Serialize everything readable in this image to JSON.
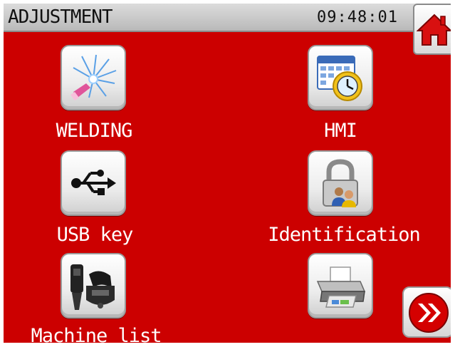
{
  "header": {
    "title": "ADJUSTMENT",
    "time": "09:48:01"
  },
  "menu": {
    "welding": "WELDING",
    "hmi": "HMI",
    "usb_key": "USB key",
    "identification": "Identification",
    "machine_list": "Machine list"
  },
  "colors": {
    "background": "#cc0000",
    "header": "#c4c4c4",
    "label_text": "#ffffff"
  },
  "icons": {
    "home": "home-icon",
    "next": "double-chevron-right-icon",
    "welding": "welding-spark-icon",
    "hmi": "calendar-clock-icon",
    "usb": "usb-icon",
    "identification": "padlock-users-icon",
    "machines": "machine-tools-icon",
    "printer": "printer-icon"
  }
}
